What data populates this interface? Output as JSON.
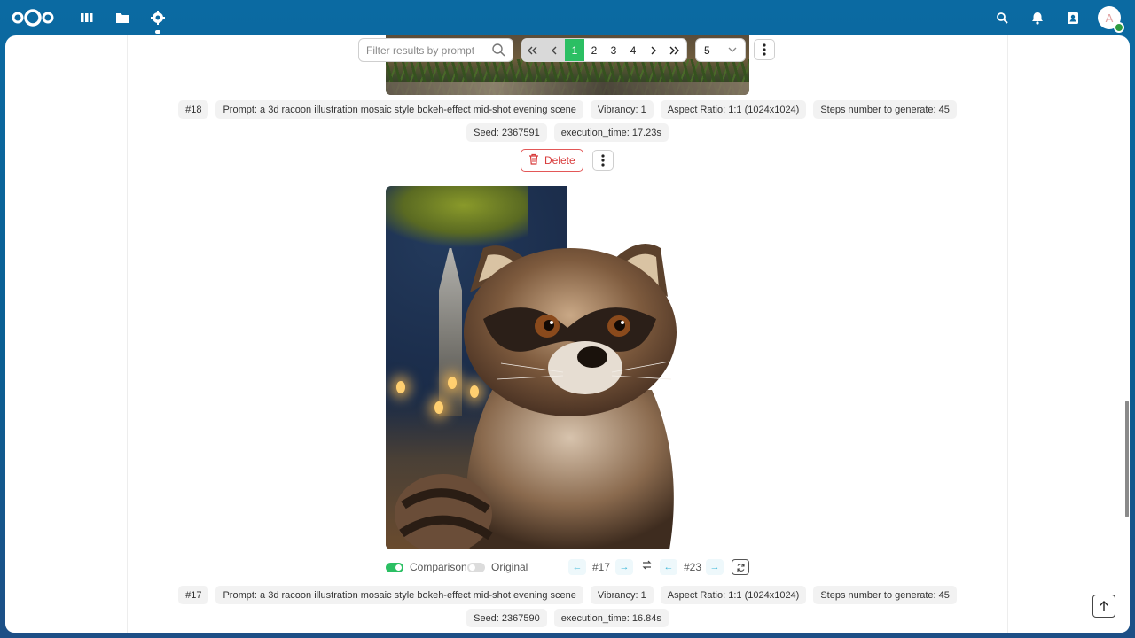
{
  "toolbar": {
    "filter_placeholder": "Filter results by prompt",
    "pages": [
      "1",
      "2",
      "3",
      "4"
    ],
    "current_page": "1",
    "per_page": "5"
  },
  "result_18": {
    "id": "#18",
    "prompt": "Prompt: a 3d racoon illustration mosaic style bokeh-effect mid-shot evening scene",
    "vibrancy": "Vibrancy: 1",
    "aspect": "Aspect Ratio: 1:1 (1024x1024)",
    "steps": "Steps number to generate: 45",
    "seed": "Seed: 2367591",
    "exec": "execution_time: 17.23s",
    "delete_label": "Delete"
  },
  "comparison": {
    "comparison_label": "Comparison",
    "original_label": "Original",
    "left_id": "#17",
    "right_id": "#23"
  },
  "result_17": {
    "id": "#17",
    "prompt": "Prompt: a 3d racoon illustration mosaic style bokeh-effect mid-shot evening scene",
    "vibrancy": "Vibrancy: 1",
    "aspect": "Aspect Ratio: 1:1 (1024x1024)",
    "steps": "Steps number to generate: 45",
    "seed": "Seed: 2367590",
    "exec": "execution_time: 16.84s"
  },
  "header": {
    "avatar_letter": "A"
  },
  "colors": {
    "header_bg": "#0b6aa2",
    "accent_green": "#2bbf63",
    "delete_red": "#d83b3b"
  }
}
